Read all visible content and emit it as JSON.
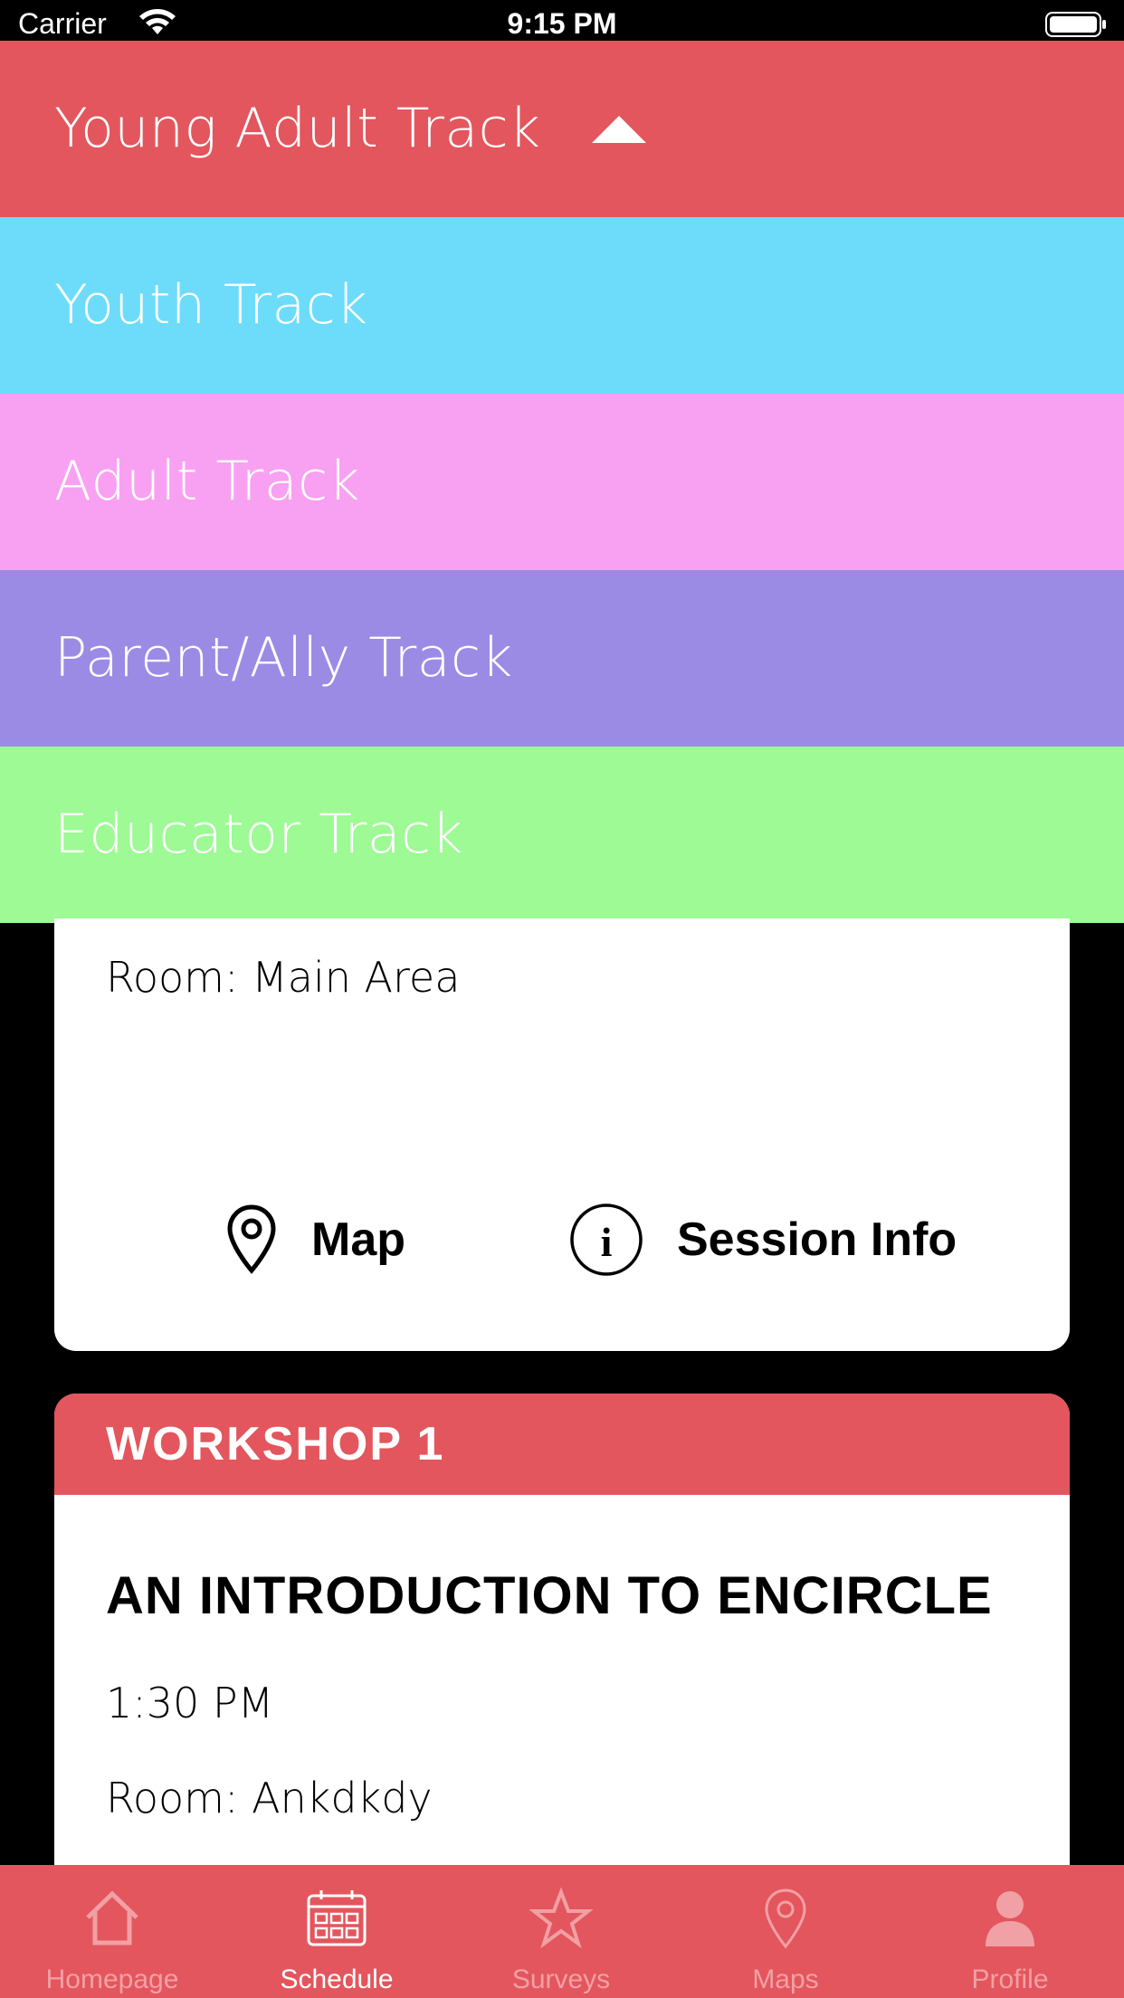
{
  "status_bar": {
    "carrier": "Carrier",
    "time": "9:15 PM"
  },
  "track_menu": {
    "selected": "Young Adult Track",
    "items": [
      {
        "label": "Youth Track",
        "color": "#6ddcfb"
      },
      {
        "label": "Adult Track",
        "color": "#f8a1f2"
      },
      {
        "label": "Parent/Ally Track",
        "color": "#9c8be5"
      },
      {
        "label": "Educator Track",
        "color": "#9dfa95"
      }
    ],
    "selected_color": "#e3565d"
  },
  "sessions": [
    {
      "room": "Room: Main Area",
      "map_label": "Map",
      "info_label": "Session Info"
    },
    {
      "header": "WORKSHOP 1",
      "title": "AN INTRODUCTION TO ENCIRCLE",
      "time": "1:30 PM",
      "room": "Room: Ankdkdy"
    }
  ],
  "tab_bar": {
    "tabs": [
      {
        "label": "Homepage",
        "icon": "home-icon"
      },
      {
        "label": "Schedule",
        "icon": "calendar-icon",
        "active": true
      },
      {
        "label": "Surveys",
        "icon": "star-icon"
      },
      {
        "label": "Maps",
        "icon": "map-pin-icon"
      },
      {
        "label": "Profile",
        "icon": "person-icon"
      }
    ]
  }
}
